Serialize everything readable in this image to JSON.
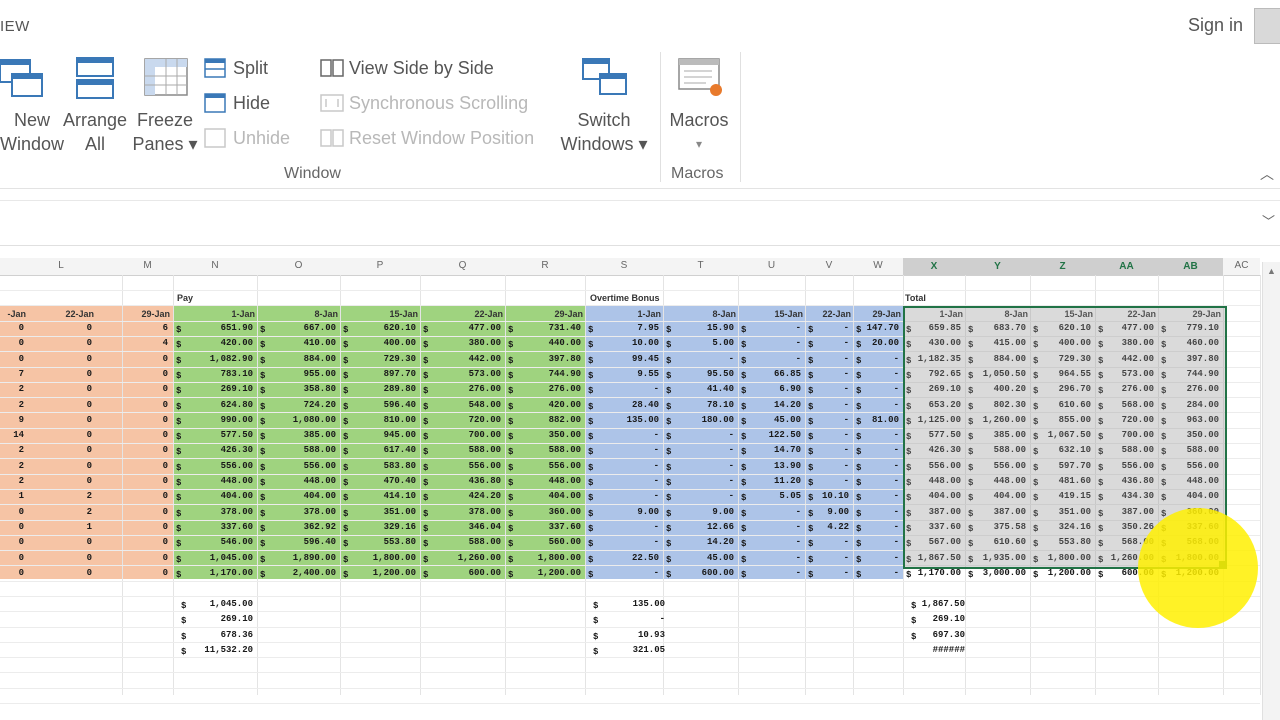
{
  "titlebar": {
    "tab": "IEW",
    "signin": "Sign in"
  },
  "ribbon": {
    "new_window": [
      "New",
      "Window"
    ],
    "arrange_all": [
      "Arrange",
      "All"
    ],
    "freeze_panes": [
      "Freeze",
      "Panes ▾"
    ],
    "split": "Split",
    "hide": "Hide",
    "unhide": "Unhide",
    "view_side_by_side": "View Side by Side",
    "synchronous_scrolling": "Synchronous Scrolling",
    "reset_window_position": "Reset Window Position",
    "switch_windows": [
      "Switch",
      "Windows ▾"
    ],
    "macros": "Macros",
    "macros_arrow": "▾",
    "group_window": "Window",
    "group_macros": "Macros"
  },
  "columns": [
    {
      "id": "L",
      "label": "L"
    },
    {
      "id": "M",
      "label": "M"
    },
    {
      "id": "N",
      "label": "N"
    },
    {
      "id": "O",
      "label": "O"
    },
    {
      "id": "P",
      "label": "P"
    },
    {
      "id": "Q",
      "label": "Q"
    },
    {
      "id": "R",
      "label": "R"
    },
    {
      "id": "S",
      "label": "S"
    },
    {
      "id": "T",
      "label": "T"
    },
    {
      "id": "U",
      "label": "U"
    },
    {
      "id": "V",
      "label": "V"
    },
    {
      "id": "W",
      "label": "W"
    },
    {
      "id": "X",
      "label": "X"
    },
    {
      "id": "Y",
      "label": "Y"
    },
    {
      "id": "Z",
      "label": "Z"
    },
    {
      "id": "AA",
      "label": "AA"
    },
    {
      "id": "AB",
      "label": "AB"
    },
    {
      "id": "AC",
      "label": "AC"
    }
  ],
  "section_labels": {
    "pay": "Pay",
    "overtime": "Overtime Bonus",
    "total": "Total"
  },
  "date_headers": {
    "left": [
      "-Jan",
      "22-Jan",
      "29-Jan"
    ],
    "pay": [
      "1-Jan",
      "8-Jan",
      "15-Jan",
      "22-Jan",
      "29-Jan"
    ],
    "overtime": [
      "1-Jan",
      "8-Jan",
      "15-Jan",
      "22-Jan",
      "29-Jan"
    ],
    "total": [
      "1-Jan",
      "8-Jan",
      "15-Jan",
      "22-Jan",
      "29-Jan"
    ]
  },
  "left_values": [
    [
      "0",
      "0",
      "6"
    ],
    [
      "0",
      "0",
      "4"
    ],
    [
      "0",
      "0",
      "0"
    ],
    [
      "7",
      "0",
      "0"
    ],
    [
      "2",
      "0",
      "0"
    ],
    [
      "2",
      "0",
      "0"
    ],
    [
      "9",
      "0",
      "0"
    ],
    [
      "14",
      "0",
      "0"
    ],
    [
      "2",
      "0",
      "0"
    ],
    [
      "2",
      "0",
      "0"
    ],
    [
      "2",
      "0",
      "0"
    ],
    [
      "1",
      "2",
      "0"
    ],
    [
      "0",
      "2",
      "0"
    ],
    [
      "0",
      "1",
      "0"
    ],
    [
      "0",
      "0",
      "0"
    ],
    [
      "0",
      "0",
      "0"
    ],
    [
      "0",
      "0",
      "0"
    ]
  ],
  "pay_values": [
    [
      "651.90",
      "667.00",
      "620.10",
      "477.00",
      "731.40"
    ],
    [
      "420.00",
      "410.00",
      "400.00",
      "380.00",
      "440.00"
    ],
    [
      "1,082.90",
      "884.00",
      "729.30",
      "442.00",
      "397.80"
    ],
    [
      "783.10",
      "955.00",
      "897.70",
      "573.00",
      "744.90"
    ],
    [
      "269.10",
      "358.80",
      "289.80",
      "276.00",
      "276.00"
    ],
    [
      "624.80",
      "724.20",
      "596.40",
      "548.00",
      "420.00"
    ],
    [
      "990.00",
      "1,080.00",
      "810.00",
      "720.00",
      "882.00"
    ],
    [
      "577.50",
      "385.00",
      "945.00",
      "700.00",
      "350.00"
    ],
    [
      "426.30",
      "588.00",
      "617.40",
      "588.00",
      "588.00"
    ],
    [
      "556.00",
      "556.00",
      "583.80",
      "556.00",
      "556.00"
    ],
    [
      "448.00",
      "448.00",
      "470.40",
      "436.80",
      "448.00"
    ],
    [
      "404.00",
      "404.00",
      "414.10",
      "424.20",
      "404.00"
    ],
    [
      "378.00",
      "378.00",
      "351.00",
      "378.00",
      "360.00"
    ],
    [
      "337.60",
      "362.92",
      "329.16",
      "346.04",
      "337.60"
    ],
    [
      "546.00",
      "596.40",
      "553.80",
      "588.00",
      "560.00"
    ],
    [
      "1,045.00",
      "1,890.00",
      "1,800.00",
      "1,260.00",
      "1,800.00"
    ],
    [
      "1,170.00",
      "2,400.00",
      "1,200.00",
      "600.00",
      "1,200.00"
    ]
  ],
  "overtime_values": [
    [
      "7.95",
      "15.90",
      "-",
      "-",
      "147.70"
    ],
    [
      "10.00",
      "5.00",
      "-",
      "-",
      "20.00"
    ],
    [
      "99.45",
      "-",
      "-",
      "-",
      "-"
    ],
    [
      "9.55",
      "95.50",
      "66.85",
      "-",
      "-"
    ],
    [
      "-",
      "41.40",
      "6.90",
      "-",
      "-"
    ],
    [
      "28.40",
      "78.10",
      "14.20",
      "-",
      "-"
    ],
    [
      "135.00",
      "180.00",
      "45.00",
      "-",
      "81.00"
    ],
    [
      "-",
      "-",
      "122.50",
      "-",
      "-"
    ],
    [
      "-",
      "-",
      "14.70",
      "-",
      "-"
    ],
    [
      "-",
      "-",
      "13.90",
      "-",
      "-"
    ],
    [
      "-",
      "-",
      "11.20",
      "-",
      "-"
    ],
    [
      "-",
      "-",
      "5.05",
      "10.10",
      "-"
    ],
    [
      "9.00",
      "9.00",
      "-",
      "9.00",
      "-"
    ],
    [
      "-",
      "12.66",
      "-",
      "4.22",
      "-"
    ],
    [
      "-",
      "14.20",
      "-",
      "-",
      "-"
    ],
    [
      "22.50",
      "45.00",
      "-",
      "-",
      "-"
    ],
    [
      "-",
      "600.00",
      "-",
      "-",
      "-"
    ]
  ],
  "total_values": [
    [
      "659.85",
      "683.70",
      "620.10",
      "477.00",
      "779.10"
    ],
    [
      "430.00",
      "415.00",
      "400.00",
      "380.00",
      "460.00"
    ],
    [
      "1,182.35",
      "884.00",
      "729.30",
      "442.00",
      "397.80"
    ],
    [
      "792.65",
      "1,050.50",
      "964.55",
      "573.00",
      "744.90"
    ],
    [
      "269.10",
      "400.20",
      "296.70",
      "276.00",
      "276.00"
    ],
    [
      "653.20",
      "802.30",
      "610.60",
      "568.00",
      "284.00"
    ],
    [
      "1,125.00",
      "1,260.00",
      "855.00",
      "720.00",
      "963.00"
    ],
    [
      "577.50",
      "385.00",
      "1,067.50",
      "700.00",
      "350.00"
    ],
    [
      "426.30",
      "588.00",
      "632.10",
      "588.00",
      "588.00"
    ],
    [
      "556.00",
      "556.00",
      "597.70",
      "556.00",
      "556.00"
    ],
    [
      "448.00",
      "448.00",
      "481.60",
      "436.80",
      "448.00"
    ],
    [
      "404.00",
      "404.00",
      "419.15",
      "434.30",
      "404.00"
    ],
    [
      "387.00",
      "387.00",
      "351.00",
      "387.00",
      "360.00"
    ],
    [
      "337.60",
      "375.58",
      "324.16",
      "350.26",
      "337.60"
    ],
    [
      "567.00",
      "610.60",
      "553.80",
      "568.00",
      "568.00"
    ],
    [
      "1,867.50",
      "1,935.00",
      "1,800.00",
      "1,260.00",
      "1,800.00"
    ],
    [
      "1,170.00",
      "3,000.00",
      "1,200.00",
      "600.00",
      "1,200.00"
    ]
  ],
  "summary": {
    "pay": [
      "1,045.00",
      "269.10",
      "678.36",
      "11,532.20"
    ],
    "overtime": [
      "135.00",
      "-",
      "10.93",
      "321.05"
    ],
    "total": [
      "1,867.50",
      "269.10",
      "697.30",
      "######"
    ]
  }
}
